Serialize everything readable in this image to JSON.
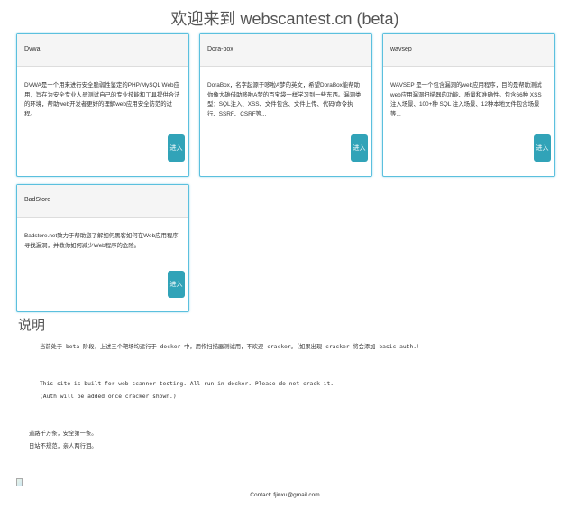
{
  "page": {
    "title": "欢迎来到 webscantest.cn (beta)"
  },
  "cards": [
    {
      "name": "Dvwa",
      "description": "DVWA是一个用来进行安全脆弱性鉴定的PHP/MySQL Web应用，旨在为安全专业人员测试自己的专业技能和工具提供合法的环境，帮助web开发者更好的理解web应用安全防范的过程。",
      "button": "进入"
    },
    {
      "name": "Dora-box",
      "description": "DoraBox，名字起源于哆啦A梦的英文，希望DoraBox能帮助你像大雄借助哆啦A梦的百宝袋一样学习到一些东西。漏洞类型：SQL注入、XSS、文件包含、文件上传、代码/命令执行、SSRF、CSRF等...",
      "button": "进入"
    },
    {
      "name": "wavsep",
      "description": "WAVSEP 是一个包含漏洞的web应用程序，目的是帮助测试web应用漏洞扫描器的功能、质量和准确性。包含66种 XSS 注入场景、100+种 SQL 注入场景、12种本地文件包含场景等...",
      "button": "进入"
    },
    {
      "name": "BadStore",
      "description": "Badstore.net致力于帮助您了解如何黑客如何在Web应用程序寻找漏洞，并教你如何减少Web程序的危险。",
      "button": "进入"
    }
  ],
  "notes": {
    "heading": "说明",
    "line1": "当前处于 beta 阶段，上述三个靶场均运行于 docker 中，用作扫描器测试用，不欢迎 cracker。（如果出现 cracker 将会添加 basic auth.）",
    "line2": "This site is built for web scanner testing. All run in docker. Please do not crack it.",
    "line3": "(Auth will be added once cracker shown.)",
    "line4": "道路千万条，安全第一条。",
    "line5": "日站不规范，亲人两行泪。"
  },
  "footer": {
    "contact": "Contact: fjinxu@gmail.com"
  }
}
